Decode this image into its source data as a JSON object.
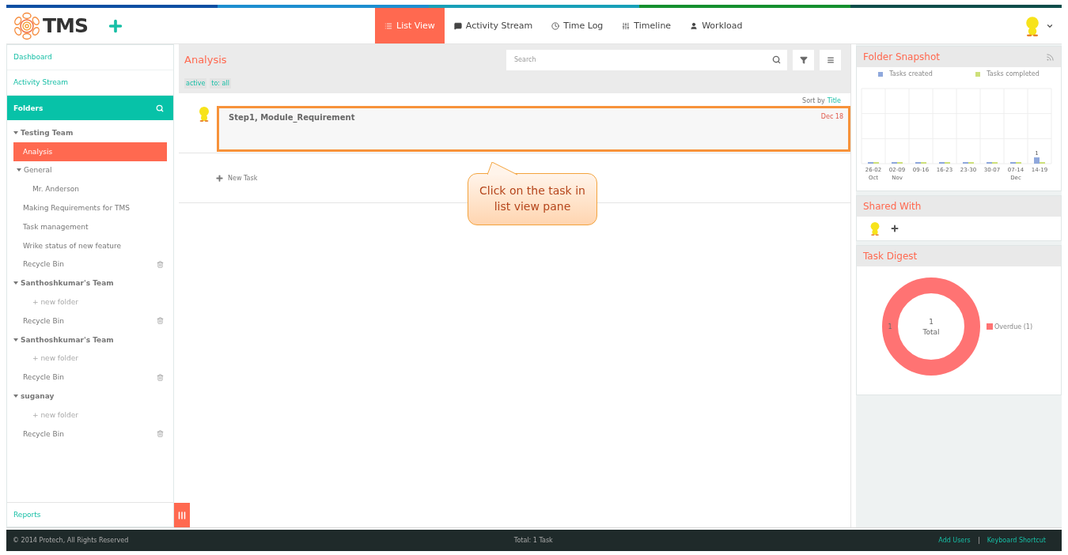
{
  "header": {
    "logo": "TMS",
    "tabs": [
      {
        "label": "List View",
        "selected": true
      },
      {
        "label": "Activity Stream",
        "selected": false
      },
      {
        "label": "Time Log",
        "selected": false
      },
      {
        "label": "Timeline",
        "selected": false
      },
      {
        "label": "Workload",
        "selected": false
      }
    ]
  },
  "sidebar": {
    "links": [
      {
        "label": "Dashboard"
      },
      {
        "label": "Activity Stream"
      }
    ],
    "folders_title": "Folders",
    "tree": [
      {
        "label": "Testing Team",
        "kind": "team",
        "expanded": true,
        "children": [
          {
            "label": "Analysis",
            "kind": "folder",
            "selected": true
          },
          {
            "label": "General",
            "kind": "folder",
            "selected": false,
            "expanded": true,
            "children": [
              {
                "label": "Mr. Anderson",
                "kind": "folder",
                "selected": false
              }
            ]
          },
          {
            "label": "Making Requirements for TMS",
            "kind": "folder",
            "selected": false
          },
          {
            "label": "Task management",
            "kind": "folder",
            "selected": false
          },
          {
            "label": "Wrike status of new feature",
            "kind": "folder",
            "selected": false
          },
          {
            "label": "Recycle Bin",
            "kind": "bin"
          }
        ]
      },
      {
        "label": "Santhoshkumar's Team",
        "kind": "team",
        "expanded": true,
        "children": [
          {
            "label": "+ new folder",
            "kind": "new"
          },
          {
            "label": "Recycle Bin",
            "kind": "bin"
          }
        ]
      },
      {
        "label": "Santhoshkumar's Team",
        "kind": "team",
        "expanded": true,
        "children": [
          {
            "label": "+ new folder",
            "kind": "new"
          },
          {
            "label": "Recycle Bin",
            "kind": "bin"
          }
        ]
      },
      {
        "label": "suganay",
        "kind": "team",
        "expanded": true,
        "children": [
          {
            "label": "+ new folder",
            "kind": "new"
          },
          {
            "label": "Recycle Bin",
            "kind": "bin"
          }
        ]
      }
    ],
    "footer_link": "Reports"
  },
  "main": {
    "title": "Analysis",
    "filters": [
      "active",
      "to: all"
    ],
    "search": {
      "placeholder": "Search"
    },
    "sort_label": "Sort by",
    "sort_value": "Title",
    "tasks": [
      {
        "title": "Step1, Module_Requirement",
        "date": "Dec 18",
        "highlighted": true
      }
    ],
    "new_task": "New Task",
    "callout": "Click on the task in list view pane"
  },
  "right": {
    "snapshot": {
      "title": "Folder Snapshot",
      "chart_data": {
        "type": "bar",
        "categories": [
          "26-02 Oct",
          "02-09 Nov",
          "09-16",
          "16-23",
          "23-30",
          "30-07",
          "07-14 Dec",
          "14-19"
        ],
        "series": [
          {
            "name": "Tasks created",
            "color": "#8fa8dc",
            "values": [
              0,
              0,
              0,
              0,
              0,
              0,
              0,
              1
            ],
            "value_labels": [
              null,
              null,
              null,
              null,
              null,
              null,
              null,
              "1"
            ]
          },
          {
            "name": "Tasks completed",
            "color": "#cde07a",
            "values": [
              0,
              0,
              0,
              0,
              0,
              0,
              0,
              0
            ],
            "value_labels": [
              null,
              null,
              null,
              null,
              null,
              null,
              null,
              null
            ]
          }
        ],
        "ylim": [
          0,
          12
        ]
      }
    },
    "shared": {
      "title": "Shared With"
    },
    "digest": {
      "title": "Task Digest",
      "center_value": "1",
      "center_label": "Total",
      "ring_label": "1",
      "legend": [
        {
          "label": "Overdue (1)",
          "color": "#ff7373"
        }
      ]
    }
  },
  "footer": {
    "copyright": "© 2014 Protech, All Rights Reserved",
    "total": "Total: 1 Task",
    "links": [
      "Add Users",
      "Keyboard Shortcut"
    ]
  }
}
